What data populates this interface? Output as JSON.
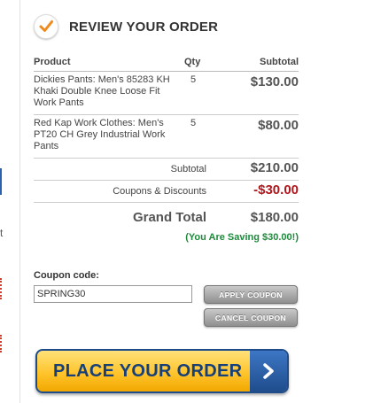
{
  "review": {
    "title": "REVIEW YOUR ORDER",
    "columns": {
      "product": "Product",
      "qty": "Qty",
      "subtotal": "Subtotal"
    },
    "items": [
      {
        "name": "Dickies Pants: Men's 85283 KH Khaki Double Knee Loose Fit Work Pants",
        "qty": "5",
        "price": "$130.00"
      },
      {
        "name": "Red Kap Work Clothes: Men's PT20 CH Grey Industrial Work Pants",
        "qty": "5",
        "price": "$80.00"
      }
    ],
    "subtotal_label": "Subtotal",
    "subtotal_value": "$210.00",
    "discount_label": "Coupons & Discounts",
    "discount_value": "-$30.00",
    "grand_total_label": "Grand Total",
    "grand_total_value": "$180.00",
    "saving_text": "(You Are Saving $30.00!)"
  },
  "coupon": {
    "label": "Coupon code:",
    "value": "SPRING30",
    "apply_label": "APPLY COUPON",
    "cancel_label": "CANCEL COUPON"
  },
  "place_order": {
    "label": "PLACE YOUR ORDER",
    "arrow_icon": "chevron-right-icon"
  },
  "left_edge": {
    "fragment": "t"
  },
  "icons": {
    "header": "checkmark-icon"
  },
  "colors": {
    "accent_orange": "#f08a1c",
    "discount_red": "#b0161b",
    "saving_green": "#1e8a3c",
    "button_blue": "#1f4d8c",
    "button_yellow": "#ffc42c"
  }
}
